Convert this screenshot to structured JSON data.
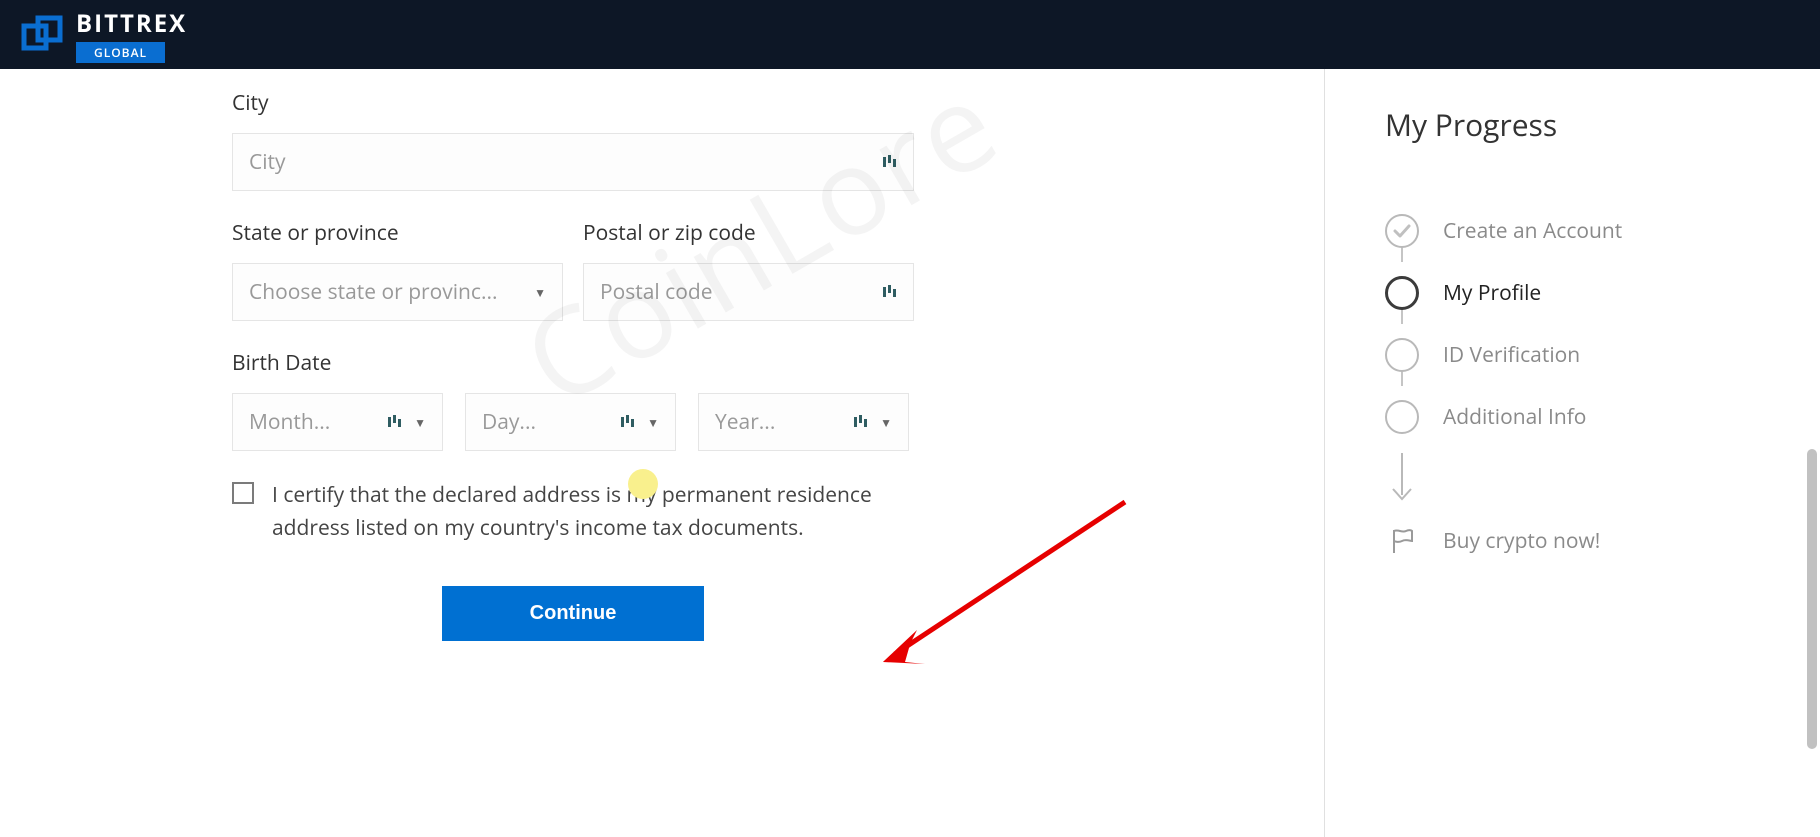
{
  "header": {
    "brand": "BITTREX",
    "sub": "GLOBAL"
  },
  "form": {
    "city": {
      "label": "City",
      "placeholder": "City"
    },
    "state": {
      "label": "State or province",
      "placeholder": "Choose state or provinc..."
    },
    "postal": {
      "label": "Postal or zip code",
      "placeholder": "Postal code"
    },
    "birth": {
      "label": "Birth Date",
      "month": "Month...",
      "day": "Day...",
      "year": "Year..."
    },
    "certify": "I certify that the declared address is my permanent residence address listed on my country's income tax documents.",
    "continue": "Continue"
  },
  "progress": {
    "title": "My Progress",
    "steps": [
      {
        "label": "Create an Account",
        "state": "done"
      },
      {
        "label": "My Profile",
        "state": "current"
      },
      {
        "label": "ID Verification",
        "state": "pending"
      },
      {
        "label": "Additional Info",
        "state": "pending"
      }
    ],
    "final": "Buy crypto now!"
  },
  "watermark": "CoinLore"
}
